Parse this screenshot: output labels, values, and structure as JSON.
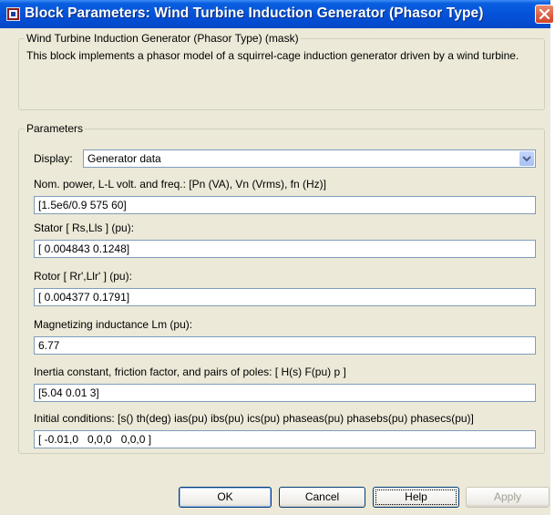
{
  "window": {
    "title": "Block Parameters: Wind Turbine Induction Generator (Phasor Type)"
  },
  "description_group": {
    "legend": "Wind Turbine Induction Generator (Phasor Type) (mask)",
    "text": "This block implements a phasor model of a squirrel-cage induction generator driven by a wind turbine."
  },
  "parameters": {
    "legend": "Parameters",
    "display_label": "Display:",
    "display_value": "Generator data",
    "fields": [
      {
        "label": "Nom. power, L-L volt. and freq.: [Pn (VA), Vn (Vrms), fn (Hz)]",
        "value": "[1.5e6/0.9 575 60]"
      },
      {
        "label": "Stator [ Rs,Lls ] (pu):",
        "value": "[ 0.004843 0.1248]"
      },
      {
        "label": "Rotor [ Rr',Llr' ] (pu):",
        "value": "[ 0.004377 0.1791]"
      },
      {
        "label": "Magnetizing inductance Lm (pu):",
        "value": "6.77"
      },
      {
        "label": "Inertia constant, friction factor, and pairs of poles: [ H(s)  F(pu)  p ]",
        "value": "[5.04 0.01 3]"
      },
      {
        "label": "Initial conditions: [s()  th(deg)  ias(pu)  ibs(pu)  ics(pu)  phaseas(pu) phasebs(pu) phasecs(pu)]",
        "value": "[ -0.01,0   0,0,0   0,0,0 ]"
      }
    ]
  },
  "buttons": {
    "ok": "OK",
    "cancel": "Cancel",
    "help": "Help",
    "apply": "Apply"
  }
}
